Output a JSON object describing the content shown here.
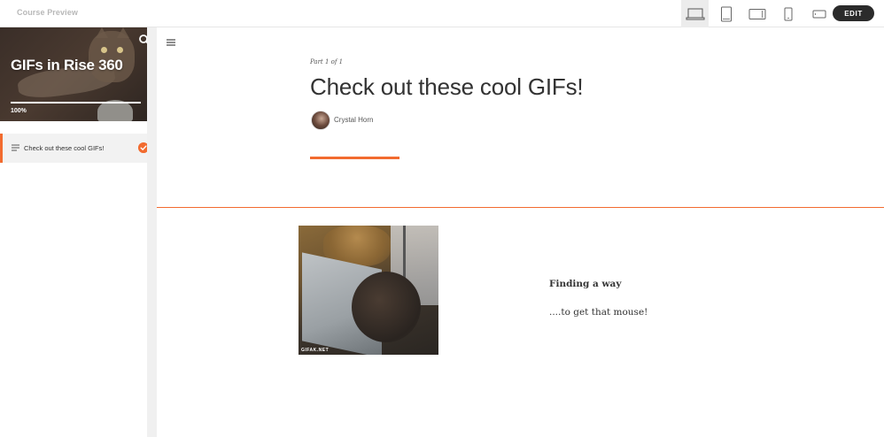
{
  "topbar": {
    "title": "Course Preview",
    "devices": [
      "laptop-icon",
      "tablet-portrait-icon",
      "tablet-landscape-icon",
      "phone-portrait-icon",
      "phone-landscape-icon"
    ],
    "active_device": "laptop-icon",
    "edit_label": "EDIT"
  },
  "sidebar": {
    "course_title": "GIFs in Rise 360",
    "progress_label": "100%",
    "progress_value": 1.0,
    "lessons": [
      {
        "label": "Check out these cool GIFs!",
        "completed": true
      }
    ]
  },
  "lesson": {
    "part_label": "Part 1 of 1",
    "title": "Check out these cool GIFs!",
    "author": "Crystal Horn"
  },
  "gif_block": {
    "watermark": "GIFAK.NET",
    "caption_title": "Finding a way",
    "caption_text": "....to get that mouse!"
  },
  "colors": {
    "accent": "#f26b2f",
    "edit_button": "#2b2b2b",
    "text": "#333333"
  }
}
